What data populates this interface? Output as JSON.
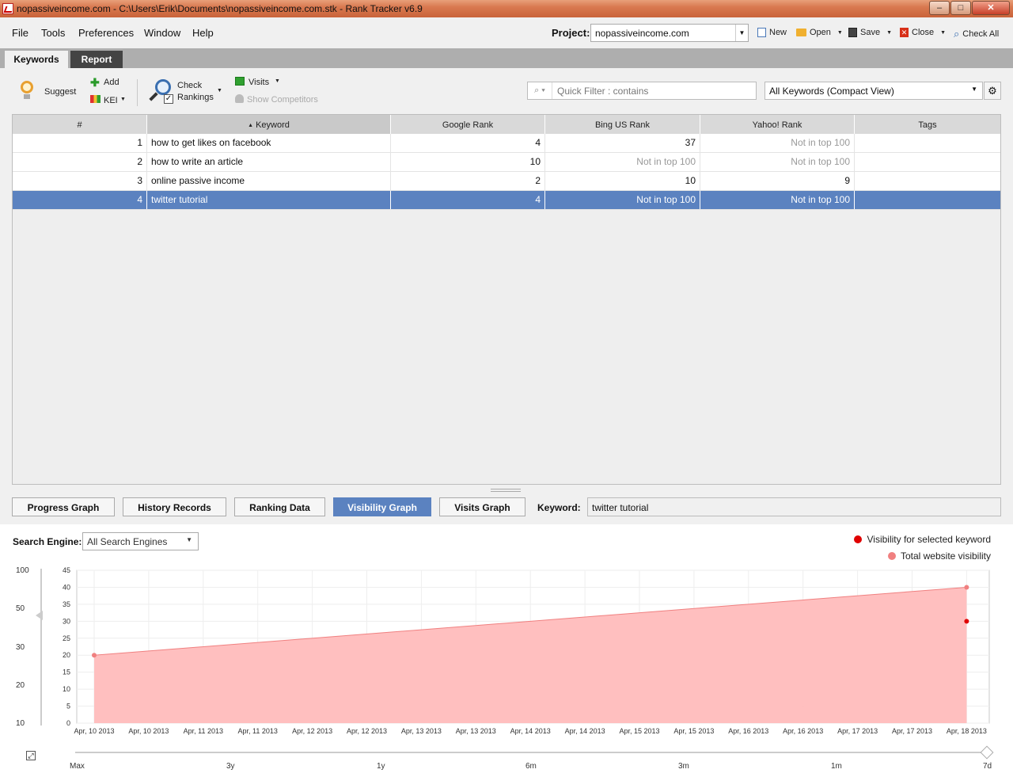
{
  "window": {
    "title": "nopassiveincome.com - C:\\Users\\Erik\\Documents\\nopassiveincome.com.stk - Rank Tracker v6.9",
    "minimize": "–",
    "maximize": "□",
    "close": "✕"
  },
  "menu": {
    "file": "File",
    "tools": "Tools",
    "preferences": "Preferences",
    "window": "Window",
    "help": "Help"
  },
  "project": {
    "label": "Project:",
    "value": "nopassiveincome.com"
  },
  "actions": {
    "new": "New",
    "open": "Open",
    "save": "Save",
    "close": "Close",
    "check_all": "Check All"
  },
  "tabs": {
    "keywords": "Keywords",
    "report": "Report"
  },
  "toolbar": {
    "suggest": "Suggest",
    "add": "Add",
    "kei": "KEI",
    "check": "Check",
    "rankings": "Rankings",
    "visits": "Visits",
    "show_competitors": "Show Competitors",
    "filter_placeholder": "Quick Filter : contains",
    "view_select": "All Keywords (Compact View)"
  },
  "table": {
    "headers": {
      "num": "#",
      "keyword": "Keyword",
      "google": "Google Rank",
      "bing": "Bing US Rank",
      "yahoo": "Yahoo! Rank",
      "tags": "Tags"
    },
    "rows": [
      {
        "num": "1",
        "keyword": "how to get likes on facebook",
        "google": "4",
        "bing": "37",
        "yahoo": "Not in top 100",
        "tags": ""
      },
      {
        "num": "2",
        "keyword": "how to write an article",
        "google": "10",
        "bing": "Not in top 100",
        "yahoo": "Not in top 100",
        "tags": ""
      },
      {
        "num": "3",
        "keyword": "online passive income",
        "google": "2",
        "bing": "10",
        "yahoo": "9",
        "tags": ""
      },
      {
        "num": "4",
        "keyword": "twitter tutorial",
        "google": "4",
        "bing": "Not in top 100",
        "yahoo": "Not in top 100",
        "tags": ""
      }
    ]
  },
  "bottom_tabs": {
    "progress": "Progress Graph",
    "history": "History Records",
    "ranking": "Ranking Data",
    "visibility": "Visibility Graph",
    "visits": "Visits Graph",
    "keyword_label": "Keyword:",
    "keyword_value": "twitter tutorial"
  },
  "graph": {
    "search_engine_label": "Search Engine:",
    "search_engine_value": "All Search Engines",
    "zoom_scale": [
      "100",
      "50",
      "30",
      "20",
      "10"
    ],
    "time_labels": [
      "Max",
      "3y",
      "1y",
      "6m",
      "3m",
      "1m",
      "7d"
    ]
  },
  "colors": {
    "selected_row": "#5b82c0",
    "area_fill": "#ffbcbc",
    "total_dot": "#f08080",
    "selected_dot": "#e00000"
  },
  "chart_data": {
    "type": "area",
    "x": [
      "Apr, 10 2013",
      "Apr, 10 2013",
      "Apr, 11 2013",
      "Apr, 11 2013",
      "Apr, 12 2013",
      "Apr, 12 2013",
      "Apr, 13 2013",
      "Apr, 13 2013",
      "Apr, 14 2013",
      "Apr, 14 2013",
      "Apr, 15 2013",
      "Apr, 15 2013",
      "Apr, 16 2013",
      "Apr, 16 2013",
      "Apr, 17 2013",
      "Apr, 17 2013",
      "Apr, 18 2013"
    ],
    "y_ticks": [
      0,
      5,
      10,
      15,
      20,
      25,
      30,
      35,
      40,
      45
    ],
    "ylim": [
      0,
      45
    ],
    "series": [
      {
        "name": "Total website visibility",
        "points": [
          {
            "x": "Apr, 10 2013",
            "y": 20
          },
          {
            "x": "Apr, 18 2013",
            "y": 40
          }
        ]
      },
      {
        "name": "Visibility for selected keyword",
        "points": [
          {
            "x": "Apr, 18 2013",
            "y": 30
          }
        ]
      }
    ],
    "grid": true,
    "legend": "top-right"
  }
}
